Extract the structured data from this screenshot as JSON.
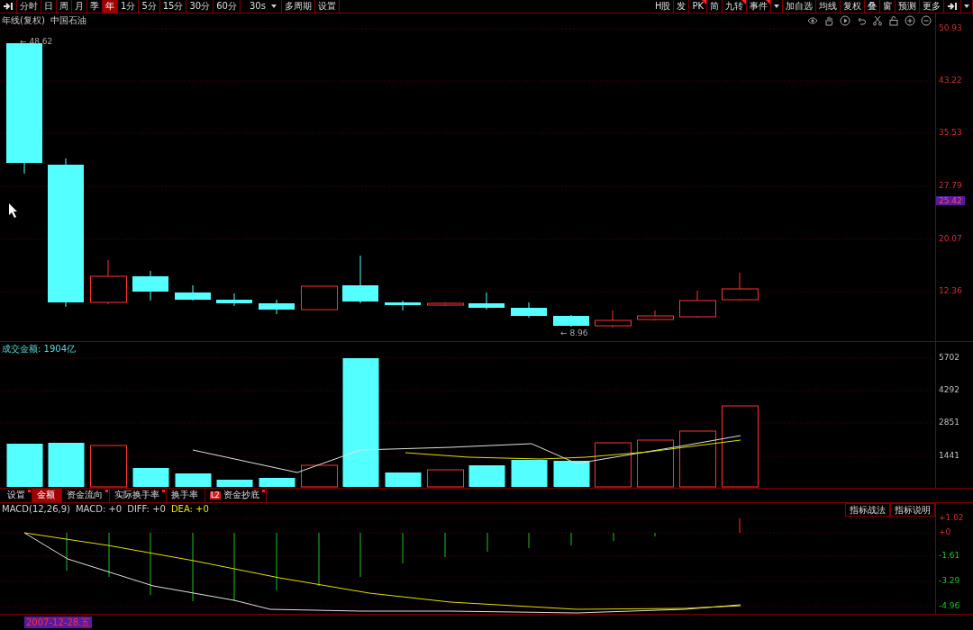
{
  "toolbar_left": [
    {
      "label": "分时",
      "selected": false
    },
    {
      "label": "日",
      "selected": false
    },
    {
      "label": "周",
      "selected": false
    },
    {
      "label": "月",
      "selected": false
    },
    {
      "label": "季",
      "selected": false
    },
    {
      "label": "年",
      "selected": true
    },
    {
      "label": "1分",
      "selected": false
    },
    {
      "label": "5分",
      "selected": false
    },
    {
      "label": "15分",
      "selected": false
    },
    {
      "label": "30分",
      "selected": false
    },
    {
      "label": "60分",
      "selected": false
    }
  ],
  "interval_select": {
    "value": "30s"
  },
  "toolbar_left_extra": [
    "多周期",
    "设置"
  ],
  "toolbar_right": [
    {
      "label": "H股",
      "marked": false
    },
    {
      "label": "发",
      "marked": false
    },
    {
      "label": "PK",
      "marked": true
    },
    {
      "label": "简",
      "marked": false
    },
    {
      "label": "九转",
      "marked": true
    },
    {
      "label": "事件",
      "marked": true
    }
  ],
  "toolbar_right_extra": [
    "加自选",
    "均线",
    "复权",
    "叠",
    "窗",
    "预测",
    "更多"
  ],
  "main_chart": {
    "title": "年线(复权)",
    "stock_name": "中国石油",
    "high_label": "← 48.62",
    "low_label": "← 8.96",
    "price_ticks": [
      "50.93",
      "43.22",
      "35.53",
      "27.79",
      "20.07",
      "12.36"
    ],
    "current_price": "25.42"
  },
  "volume_chart": {
    "title": "成交金额: 1904亿",
    "ticks": [
      "5702",
      "4292",
      "2851",
      "1441"
    ]
  },
  "indicator_tabs": [
    {
      "label": "设置",
      "selected": false,
      "marked": true
    },
    {
      "label": "金额",
      "selected": true,
      "marked": false
    },
    {
      "label": "资金流向",
      "selected": false,
      "marked": true
    },
    {
      "label": "实际换手率",
      "selected": false,
      "marked": true
    },
    {
      "label": "换手率",
      "selected": false,
      "marked": false
    },
    {
      "label": "资金抄底",
      "selected": false,
      "marked": true,
      "badge": "L2"
    }
  ],
  "macd_chart": {
    "legend": [
      {
        "text": "MACD(12,26,9)",
        "color": "#d0d0d0"
      },
      {
        "text": "MACD: +0",
        "color": "#d0d0d0"
      },
      {
        "text": "DIFF: +0",
        "color": "#d0d0d0"
      },
      {
        "text": "DEA: +0",
        "color": "#e8e800"
      }
    ],
    "buttons": [
      "指标战法",
      "指标说明"
    ],
    "ticks": [
      {
        "label": "+1.02",
        "kind": "positive"
      },
      {
        "label": "+0",
        "kind": "positive"
      },
      {
        "label": "-1.61",
        "kind": "negative"
      },
      {
        "label": "-3.29",
        "kind": "negative"
      },
      {
        "label": "-4.96",
        "kind": "negative"
      }
    ]
  },
  "date_label": "2007-12-28.五"
}
